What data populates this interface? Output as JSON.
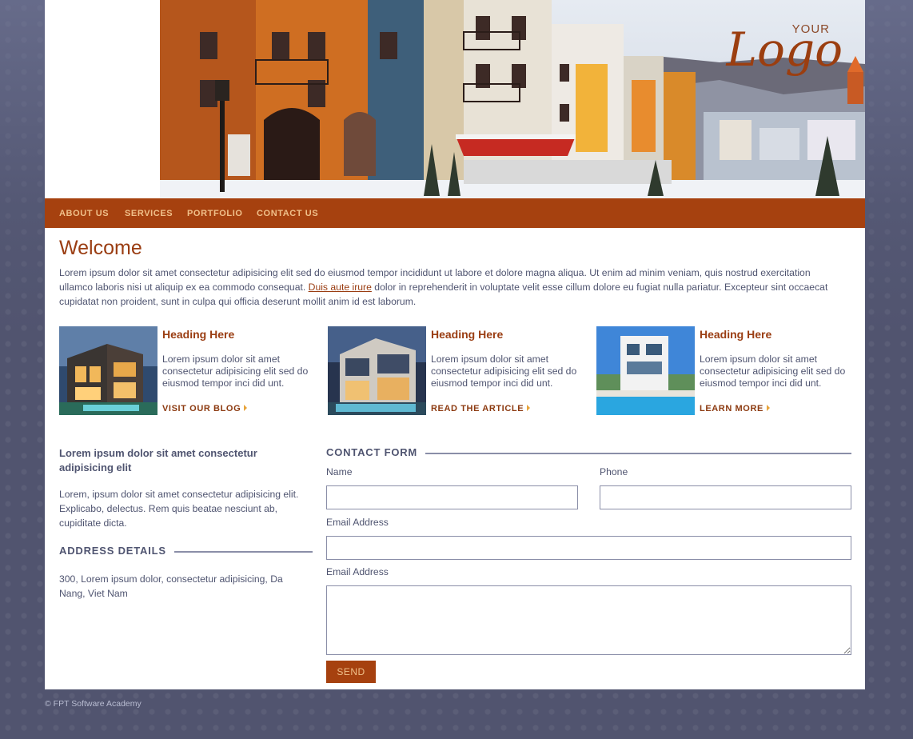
{
  "header": {
    "logo_small": "YOUR",
    "logo_word": "Logo"
  },
  "nav": {
    "items": [
      {
        "label": "ABOUT US"
      },
      {
        "label": "SERVICES"
      },
      {
        "label": "PORTFOLIO"
      },
      {
        "label": "CONTACT US"
      }
    ]
  },
  "intro": {
    "title": "Welcome",
    "text_before": "Lorem ipsum dolor sit amet consectetur adipisicing elit sed do eiusmod tempor incididunt ut labore et dolore magna aliqua. Ut enim ad minim veniam, quis nostrud exercitation ullamco laboris nisi ut aliquip ex ea commodo consequat. ",
    "link_text": "Duis aute irure",
    "text_after": " dolor in reprehenderit in voluptate velit esse cillum dolore eu fugiat nulla pariatur. Excepteur sint occaecat cupidatat non proident, sunt in culpa qui officia deserunt mollit anim id est laborum."
  },
  "features": [
    {
      "heading": "Heading Here",
      "text": "Lorem ipsum dolor sit amet consectetur adipisicing elit sed do eiusmod tempor inci did unt.",
      "link": "VISIT OUR BLOG"
    },
    {
      "heading": "Heading Here",
      "text": "Lorem ipsum dolor sit amet consectetur adipisicing elit sed do eiusmod tempor inci did unt.",
      "link": "READ THE ARTICLE"
    },
    {
      "heading": "Heading Here",
      "text": "Lorem ipsum dolor sit amet consectetur adipisicing elit sed do eiusmod tempor inci did unt.",
      "link": "LEARN MORE"
    }
  ],
  "sidebar": {
    "title": "Lorem ipsum dolor sit amet consectetur adipisicing elit",
    "text": "Lorem, ipsum dolor sit amet consectetur adipisicing elit. Explicabo, delectus. Rem quis beatae nesciunt ab, cupiditate dicta.",
    "address_heading": "ADDRESS DETAILS",
    "address": "300, Lorem ipsum dolor, consectetur adipisicing, Da Nang, Viet Nam"
  },
  "contact_form": {
    "heading": "CONTACT FORM",
    "name_label": "Name",
    "name_value": "",
    "phone_label": "Phone",
    "phone_value": "",
    "email_label": "Email Address",
    "email_value": "",
    "message_label": "Email Address",
    "message_value": "",
    "send_label": "SEND"
  },
  "footer": {
    "text": "© FPT Software Academy"
  },
  "colors": {
    "accent": "#a6410f",
    "heading": "#9a3d12",
    "nav_text": "#f0c08a",
    "background": "#51546f",
    "text": "#4f5470"
  }
}
